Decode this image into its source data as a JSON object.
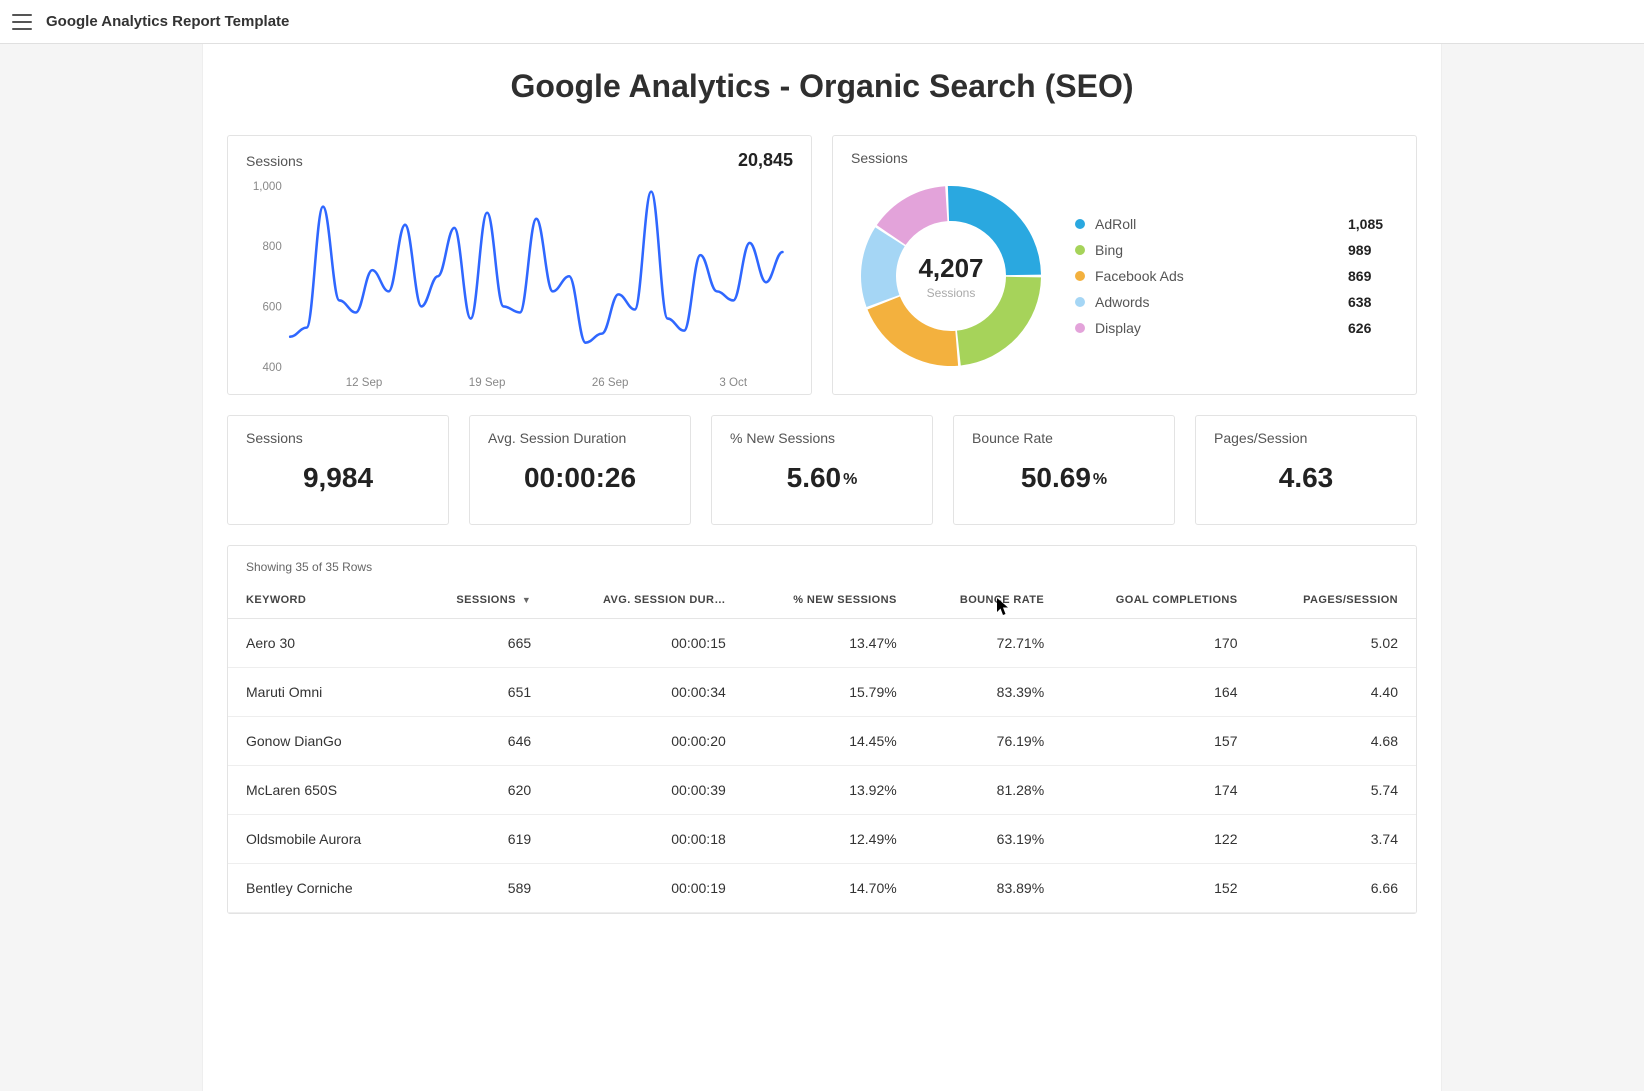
{
  "topbar": {
    "title": "Google Analytics Report Template"
  },
  "page": {
    "title": "Google Analytics - Organic Search (SEO)"
  },
  "lineChart": {
    "label": "Sessions",
    "total": "20,845"
  },
  "donut": {
    "label": "Sessions",
    "centerValue": "4,207",
    "centerLabel": "Sessions"
  },
  "kpis": [
    {
      "label": "Sessions",
      "value": "9,984",
      "suffix": ""
    },
    {
      "label": "Avg. Session Duration",
      "value": "00:00:26",
      "suffix": ""
    },
    {
      "label": "% New Sessions",
      "value": "5.60",
      "suffix": "%"
    },
    {
      "label": "Bounce Rate",
      "value": "50.69",
      "suffix": "%"
    },
    {
      "label": "Pages/Session",
      "value": "4.63",
      "suffix": ""
    }
  ],
  "table": {
    "meta": "Showing 35 of 35 Rows",
    "headers": [
      "KEYWORD",
      "SESSIONS",
      "AVG. SESSION DUR…",
      "% NEW SESSIONS",
      "BOUNCE RATE",
      "GOAL COMPLETIONS",
      "PAGES/SESSION"
    ],
    "sortColIndex": 1,
    "rows": [
      [
        "Aero 30",
        "665",
        "00:00:15",
        "13.47%",
        "72.71%",
        "170",
        "5.02"
      ],
      [
        "Maruti Omni",
        "651",
        "00:00:34",
        "15.79%",
        "83.39%",
        "164",
        "4.40"
      ],
      [
        "Gonow DianGo",
        "646",
        "00:00:20",
        "14.45%",
        "76.19%",
        "157",
        "4.68"
      ],
      [
        "McLaren 650S",
        "620",
        "00:00:39",
        "13.92%",
        "81.28%",
        "174",
        "5.74"
      ],
      [
        "Oldsmobile Aurora",
        "619",
        "00:00:18",
        "12.49%",
        "63.19%",
        "122",
        "3.74"
      ],
      [
        "Bentley Corniche",
        "589",
        "00:00:19",
        "14.70%",
        "83.89%",
        "152",
        "6.66"
      ]
    ]
  },
  "chart_data": [
    {
      "type": "line",
      "title": "Sessions",
      "ylabel": "Sessions",
      "ylim": [
        400,
        1000
      ],
      "y_ticks": [
        400,
        600,
        800,
        1000
      ],
      "x_ticks": [
        "12 Sep",
        "19 Sep",
        "26 Sep",
        "3 Oct"
      ],
      "series": [
        {
          "name": "Sessions",
          "values": [
            500,
            530,
            930,
            620,
            580,
            720,
            650,
            870,
            600,
            700,
            860,
            560,
            910,
            600,
            580,
            890,
            650,
            700,
            480,
            510,
            640,
            590,
            980,
            560,
            520,
            770,
            650,
            620,
            810,
            680,
            780
          ]
        }
      ]
    },
    {
      "type": "pie",
      "title": "Sessions",
      "total_label": "4,207",
      "series": [
        {
          "name": "AdRoll",
          "value": 1085,
          "color": "#2aa8e0"
        },
        {
          "name": "Bing",
          "value": 989,
          "color": "#a6d35a"
        },
        {
          "name": "Facebook Ads",
          "value": 869,
          "color": "#f3b13e"
        },
        {
          "name": "Adwords",
          "value": 638,
          "color": "#a5d6f5"
        },
        {
          "name": "Display",
          "value": 626,
          "color": "#e3a3da"
        }
      ]
    }
  ]
}
